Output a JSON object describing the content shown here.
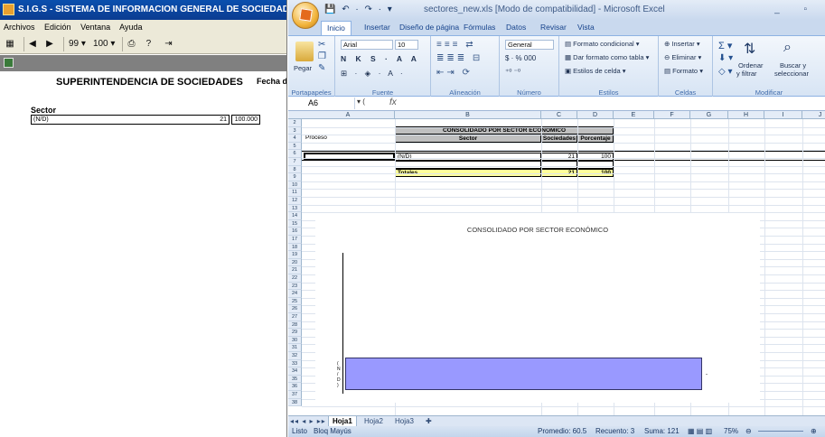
{
  "sigs": {
    "title": "S.I.G.S   - SISTEMA DE INFORMACION GENERAL DE SOCIEDADES - DANIEL",
    "menu": [
      "Archivos",
      "Edición",
      "Ventana",
      "Ayuda"
    ],
    "toolbar": {
      "page": "99",
      "zoom": "100"
    },
    "heading": "SUPERINTENDENCIA DE SOCIEDADES",
    "fecha": "Fecha de",
    "sector_label": "Sector",
    "row": {
      "sector": "(N/D)",
      "count": "21",
      "pct": "100.000"
    }
  },
  "excel": {
    "title": "sectores_new.xls  [Modo de compatibilidad] - Microsoft Excel",
    "tabs": [
      "Inicio",
      "Insertar",
      "Diseño de página",
      "Fórmulas",
      "Datos",
      "Revisar",
      "Vista"
    ],
    "ribbon": {
      "paste": "Pegar",
      "clipboard": "Portapapeles",
      "font_name": "Arial",
      "font_size": "10",
      "font_group": "Fuente",
      "align_group": "Alineación",
      "number_format": "General",
      "number_group": "Número",
      "cond_format": "Formato condicional",
      "table_format": "Dar formato como tabla",
      "cell_styles": "Estilos de celda",
      "styles_group": "Estilos",
      "insert": "Insertar",
      "delete": "Eliminar",
      "format": "Formato",
      "cells_group": "Celdas",
      "sort": "Ordenar",
      "sort2": "y filtrar",
      "find": "Buscar y",
      "find2": "seleccionar",
      "modify_group": "Modificar"
    },
    "namebox": "A6",
    "fx": "fx",
    "columns": [
      "A",
      "B",
      "C",
      "D",
      "E",
      "F",
      "G",
      "H",
      "I",
      "J"
    ],
    "rows": [
      "2",
      "3",
      "4",
      "5",
      "6",
      "7",
      "8",
      "9",
      "10",
      "11",
      "12",
      "13",
      "14",
      "15",
      "16",
      "17",
      "18",
      "19",
      "20",
      "21",
      "22",
      "23",
      "24",
      "25",
      "26",
      "27",
      "28",
      "29",
      "30",
      "31",
      "32",
      "33",
      "34",
      "35",
      "36",
      "37",
      "38"
    ],
    "table": {
      "header": "CONSOLIDADO POR SECTOR ECONÓMICO",
      "proceso": "Proceso",
      "col_sector": "Sector",
      "col_soc": "Sociedades",
      "col_pct": "Porcentaje",
      "row_sector": "(N/D)",
      "row_soc": "21",
      "row_pct": "100",
      "tot_label": "Totales",
      "tot_soc": "21",
      "tot_pct": "100"
    },
    "chart_title": "CONSOLIDADO POR SECTOR ECONÓMICO",
    "sheets": [
      "Hoja1",
      "Hoja2",
      "Hoja3"
    ],
    "status": {
      "ready": "Listo",
      "caps": "Bloq Mayús",
      "avg": "Promedio: 60.5",
      "count": "Recuento: 3",
      "sum": "Suma: 121",
      "zoom": "75%"
    }
  },
  "chart_data": {
    "type": "bar",
    "title": "CONSOLIDADO POR SECTOR ECONÓMICO",
    "categories": [
      "(N/D)"
    ],
    "values": [
      21
    ],
    "orientation": "horizontal"
  }
}
